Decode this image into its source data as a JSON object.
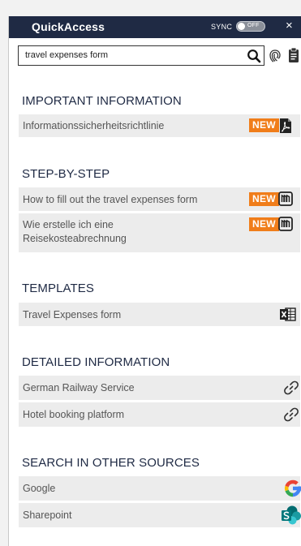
{
  "header": {
    "title": "QuickAccess",
    "sync_label": "SYNC",
    "sync_state": "OFF",
    "close_label": "×"
  },
  "search": {
    "value": "travel expenses form",
    "placeholder": ""
  },
  "colors": {
    "header_bg": "#1f2a44",
    "accent_new": "#f07d1a",
    "row_bg": "#ececec"
  },
  "sections": [
    {
      "title": "IMPORTANT INFORMATION",
      "items": [
        {
          "label": "Informationssicherheitsrichtlinie",
          "badge": "NEW",
          "icon": "pdf-icon"
        }
      ]
    },
    {
      "title": "STEP-BY-STEP",
      "items": [
        {
          "label": "How to fill out the travel expenses form",
          "badge": "NEW",
          "icon": "book-icon"
        },
        {
          "label_line1": "Wie erstelle ich eine",
          "label_line2": "Reisekosteabrechnung",
          "badge": "NEW",
          "icon": "book-icon"
        }
      ]
    },
    {
      "title": "TEMPLATES",
      "items": [
        {
          "label": "Travel Expenses form",
          "icon": "excel-icon"
        }
      ]
    },
    {
      "title": "DETAILED INFORMATION",
      "items": [
        {
          "label": "German Railway Service",
          "icon": "link-icon"
        },
        {
          "label": "Hotel booking platform",
          "icon": "link-icon"
        }
      ]
    },
    {
      "title": "SEARCH IN OTHER SOURCES",
      "items": [
        {
          "label": "Google",
          "icon": "google-icon"
        },
        {
          "label": "Sharepoint",
          "icon": "sharepoint-icon"
        }
      ]
    }
  ]
}
